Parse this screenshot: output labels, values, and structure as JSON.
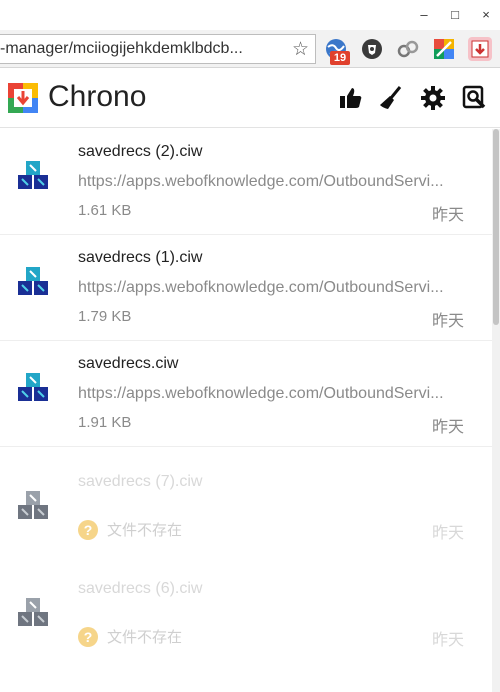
{
  "browser": {
    "url_text": "-manager/mciiogijehkdemklbdcb...",
    "window_controls": {
      "minimize": "–",
      "maximize": "□",
      "close": "×"
    },
    "extensions": [
      {
        "icon": "globe-extension-icon",
        "badge": "19"
      },
      {
        "icon": "shield-extension-icon"
      },
      {
        "icon": "link-extension-icon"
      },
      {
        "icon": "colorful-extension-icon"
      },
      {
        "icon": "chrono-extension-icon"
      }
    ]
  },
  "app": {
    "title": "Chrono",
    "header_icons": [
      "thumbs-up-icon",
      "broom-icon",
      "gear-icon",
      "search-icon"
    ]
  },
  "downloads": [
    {
      "name": "savedrecs (2).ciw",
      "url": "https://apps.webofknowledge.com/OutboundServi...",
      "size": "1.61 KB",
      "date": "昨天"
    },
    {
      "name": "savedrecs (1).ciw",
      "url": "https://apps.webofknowledge.com/OutboundServi...",
      "size": "1.79 KB",
      "date": "昨天"
    },
    {
      "name": "savedrecs.ciw",
      "url": "https://apps.webofknowledge.com/OutboundServi...",
      "size": "1.91 KB",
      "date": "昨天"
    },
    {
      "name": "savedrecs (7).ciw",
      "status": "文件不存在",
      "date": "昨天"
    },
    {
      "name": "savedrecs (6).ciw",
      "status": "文件不存在",
      "date": "昨天"
    }
  ],
  "colors": {
    "accent_red": "#e0402d",
    "muted_text": "#8a8a8a",
    "faded_text": "#d8d8d8",
    "warning": "#f6d58a"
  }
}
